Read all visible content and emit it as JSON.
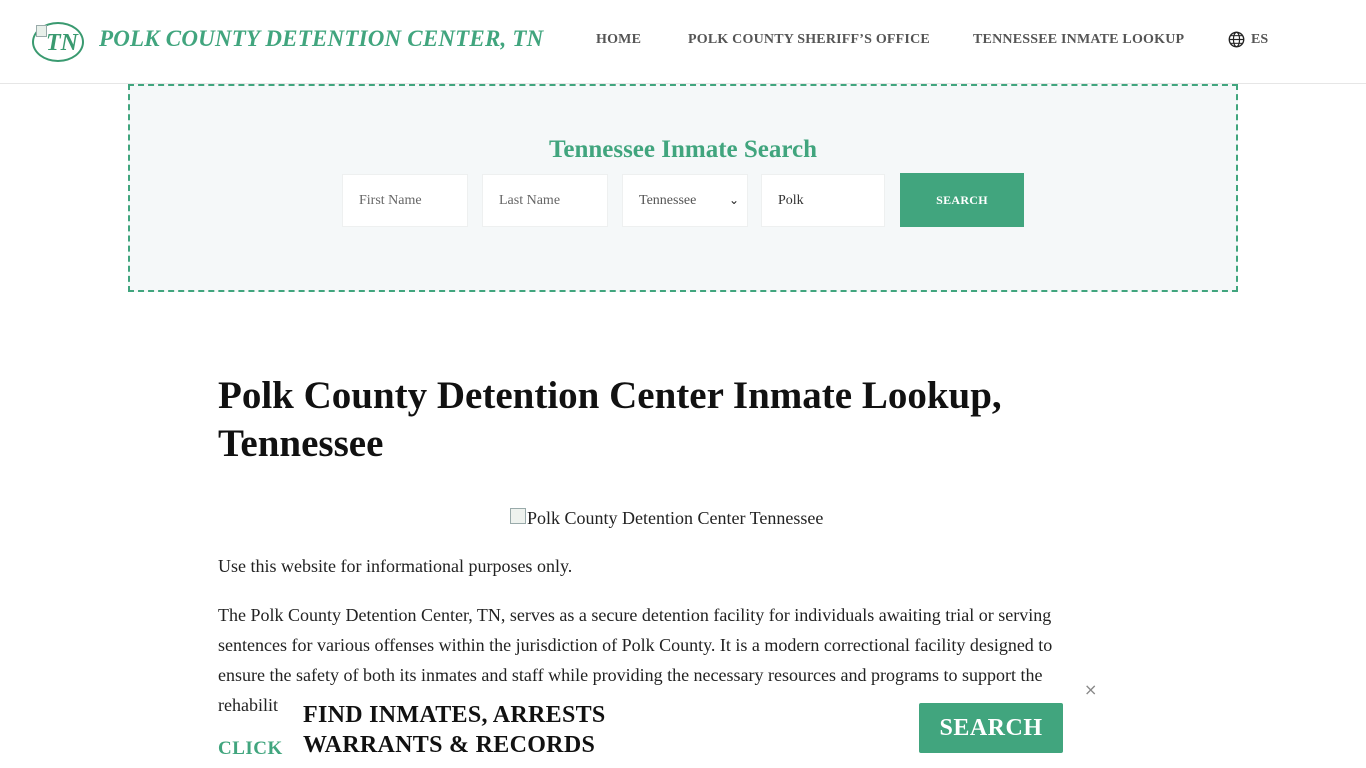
{
  "header": {
    "logo_text": "TN",
    "brand": "POLK COUNTY DETENTION CENTER, TN",
    "nav": {
      "home": "HOME",
      "sheriff": "POLK COUNTY SHERIFF’S OFFICE",
      "lookup": "TENNESSEE INMATE LOOKUP"
    },
    "language": "ES",
    "globe_icon": "globe-icon"
  },
  "search": {
    "title": "Tennessee Inmate Search",
    "first_name_placeholder": "First Name",
    "last_name_placeholder": "Last Name",
    "state_selected": "Tennessee",
    "county_value": "Polk",
    "button_label": "SEARCH"
  },
  "content": {
    "heading_line1": "Polk County Detention Center Inmate Lookup,",
    "heading_line2": "Tennessee",
    "image_alt": "Polk County Detention Center Tennessee",
    "disclaimer": "Use this website for informational purposes only.",
    "paragraph_line1": "The Polk County Detention Center, TN, serves as a secure detention facility for individuals awaiting trial or serving",
    "paragraph_line2": "sentences for various offenses within the jurisdiction of Polk County. It is a modern correctional facility designed to",
    "paragraph_line3": "ensure the safety of both its inmates and staff while providing the necessary resources and programs to support the",
    "paragraph_line4": "rehabilit",
    "click_link": "CLICK"
  },
  "ad": {
    "line1": "FIND INMATES, ARRESTS",
    "line2": "WARRANTS & RECORDS",
    "button_label": "SEARCH",
    "close_glyph": "×"
  },
  "colors": {
    "accent": "#41a57e",
    "panel_bg": "#f5f8f9",
    "nav_text": "#555555"
  }
}
